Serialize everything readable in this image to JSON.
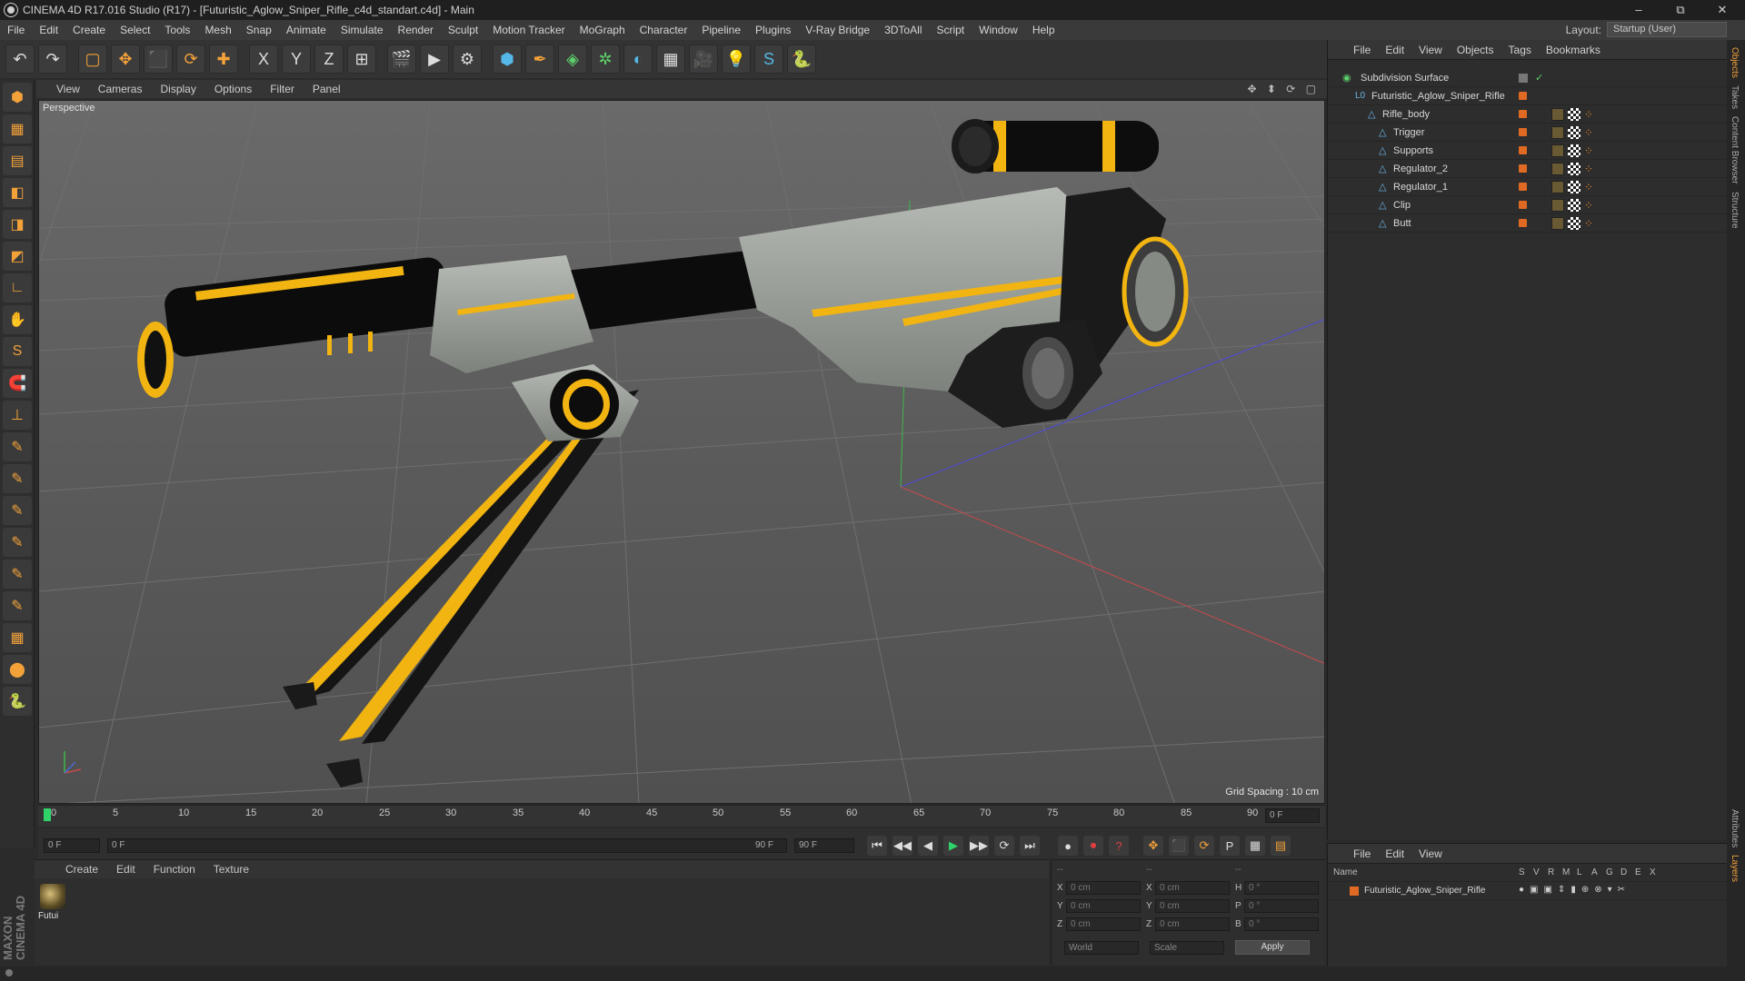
{
  "app": {
    "title": "CINEMA 4D R17.016 Studio (R17) - [Futuristic_Aglow_Sniper_Rifle_c4d_standart.c4d] - Main",
    "window_controls": [
      "–",
      "⧉",
      "✕"
    ]
  },
  "menu": [
    "File",
    "Edit",
    "Create",
    "Select",
    "Tools",
    "Mesh",
    "Snap",
    "Animate",
    "Simulate",
    "Render",
    "Sculpt",
    "Motion Tracker",
    "MoGraph",
    "Character",
    "Pipeline",
    "Plugins",
    "V-Ray Bridge",
    "3DToAll",
    "Script",
    "Window",
    "Help"
  ],
  "layout": {
    "label": "Layout:",
    "value": "Startup (User)"
  },
  "toolbar": {
    "icons": [
      "undo-icon",
      "redo-icon",
      "select-icon",
      "move-icon",
      "scale-icon",
      "rotate-icon",
      "add-icon",
      "x-axis-icon",
      "y-axis-icon",
      "z-axis-icon",
      "coord-system-icon",
      "render-view-icon",
      "render-picture-viewer-icon",
      "render-settings-icon",
      "cube-icon",
      "pen-icon",
      "subdivision-icon",
      "array-icon",
      "deformer-icon",
      "floor-icon",
      "camera-icon",
      "light-icon",
      "vray-icon",
      "python-icon"
    ],
    "glyphs": [
      "↶",
      "↷",
      "▢",
      "✥",
      "⬛",
      "⟳",
      "✚",
      "X",
      "Y",
      "Z",
      "⊞",
      "🎬",
      "▶",
      "⚙",
      "⬢",
      "✒",
      "◈",
      "✲",
      "◐",
      "▦",
      "🎥",
      "💡",
      "S",
      "🐍"
    ]
  },
  "left_tools": [
    "⬢",
    "▦",
    "▤",
    "◧",
    "◨",
    "◩",
    "∟",
    "✋",
    "S",
    "🧲",
    "⊥",
    "✎",
    "✎",
    "✎",
    "✎",
    "✎",
    "✎",
    "▦",
    "⬤",
    "🐍"
  ],
  "viewport": {
    "menu": [
      "View",
      "Cameras",
      "Display",
      "Options",
      "Filter",
      "Panel"
    ],
    "nav_icons": "✥ ⬍ ⟳ ▢",
    "label": "Perspective",
    "grid_spacing": "Grid Spacing : 10 cm"
  },
  "timeline": {
    "ticks": [
      "0",
      "5",
      "10",
      "15",
      "20",
      "25",
      "30",
      "35",
      "40",
      "45",
      "50",
      "55",
      "60",
      "65",
      "70",
      "75",
      "80",
      "85",
      "90"
    ],
    "current_frame": "0 F",
    "frame_end_field": "0 F"
  },
  "playback": {
    "start": "0 F",
    "range_start": "0 F",
    "range_end": "90 F",
    "end": "90 F",
    "buttons": [
      "⏮",
      "◀◀",
      "◀",
      "▶",
      "▶▶",
      "⟳",
      "⏭"
    ],
    "key_buttons": [
      "●",
      "⏺",
      "?",
      "✥",
      "⬛",
      "⟳",
      "P",
      "▦",
      "▤"
    ]
  },
  "materials": {
    "menu": [
      "Create",
      "Edit",
      "Function",
      "Texture"
    ],
    "items": [
      {
        "label": "Futui"
      }
    ]
  },
  "coordinates": {
    "rows": [
      {
        "a": "X",
        "av": "0 cm",
        "b": "X",
        "bv": "0 cm",
        "c": "H",
        "cv": "0 °"
      },
      {
        "a": "Y",
        "av": "0 cm",
        "b": "Y",
        "bv": "0 cm",
        "c": "P",
        "cv": "0 °"
      },
      {
        "a": "Z",
        "av": "0 cm",
        "b": "Z",
        "bv": "0 cm",
        "c": "B",
        "cv": "0 °"
      }
    ],
    "header": [
      "--",
      "--",
      "--"
    ],
    "mode": "World",
    "transform": "Scale",
    "apply": "Apply"
  },
  "object_manager": {
    "menu": [
      "File",
      "Edit",
      "View",
      "Objects",
      "Tags",
      "Bookmarks"
    ],
    "objects": [
      {
        "name": "Subdivision Surface",
        "indent": 0,
        "icon": "◉"
      },
      {
        "name": "Futuristic_Aglow_Sniper_Rifle",
        "indent": 1,
        "icon": "L0"
      },
      {
        "name": "Rifle_body",
        "indent": 2,
        "icon": "△"
      },
      {
        "name": "Trigger",
        "indent": 3,
        "icon": "△"
      },
      {
        "name": "Supports",
        "indent": 3,
        "icon": "△"
      },
      {
        "name": "Regulator_2",
        "indent": 3,
        "icon": "△"
      },
      {
        "name": "Regulator_1",
        "indent": 3,
        "icon": "△"
      },
      {
        "name": "Clip",
        "indent": 3,
        "icon": "△"
      },
      {
        "name": "Butt",
        "indent": 3,
        "icon": "△"
      }
    ]
  },
  "layer_manager": {
    "menu": [
      "File",
      "Edit",
      "View"
    ],
    "columns": [
      "Name",
      "S",
      "V",
      "R",
      "M",
      "L",
      "A",
      "G",
      "D",
      "E",
      "X"
    ],
    "layers": [
      {
        "name": "Futuristic_Aglow_Sniper_Rifle"
      }
    ]
  },
  "right_tabs": [
    "Objects",
    "Takes",
    "Content Browser",
    "Structure",
    "Attributes",
    "Layers"
  ],
  "branding": "MAXON CINEMA 4D",
  "colors": {
    "accent": "#f3a23a",
    "layer_color": "#e06a24",
    "rifle_glow": "#f2b411"
  }
}
